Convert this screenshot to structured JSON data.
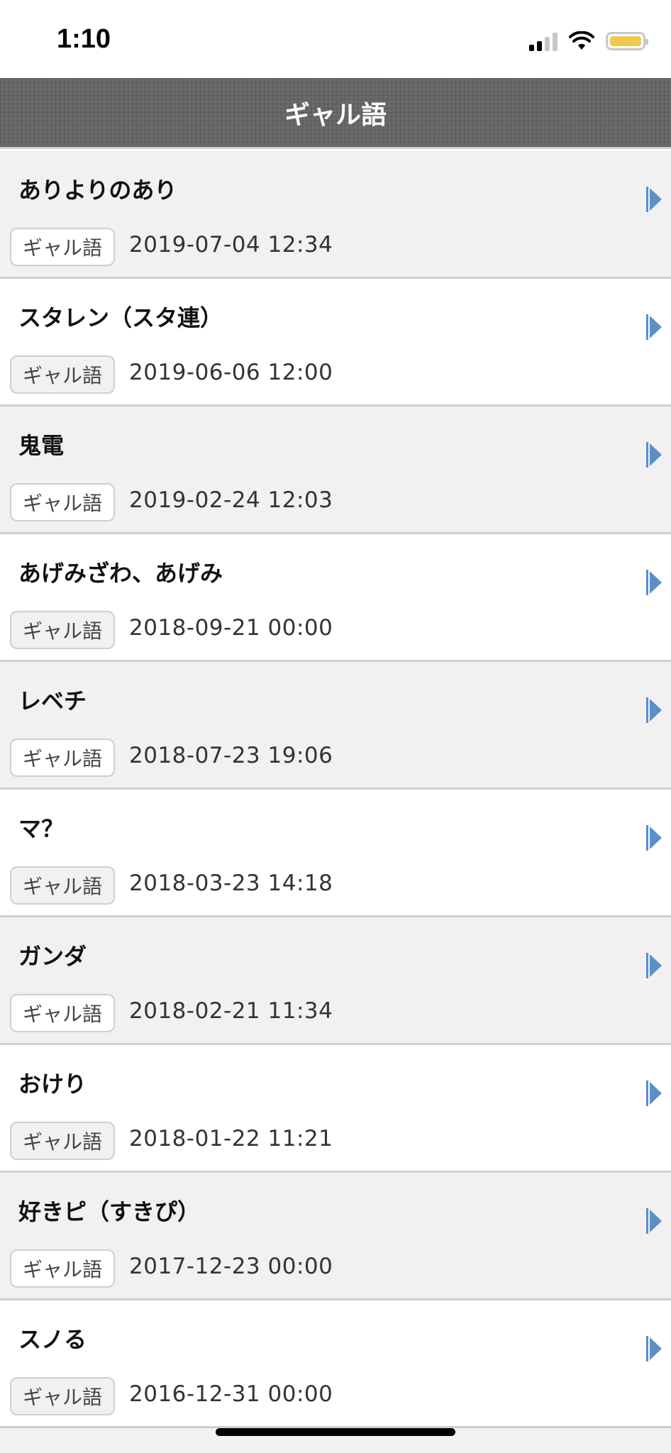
{
  "status_bar": {
    "time": "1:10"
  },
  "navbar": {
    "title": "ギャル語"
  },
  "items": [
    {
      "word": "ありよりのあり",
      "tag": "ギャル語",
      "date": "2019-07-04 12:34"
    },
    {
      "word": "スタレン（スタ連）",
      "tag": "ギャル語",
      "date": "2019-06-06 12:00"
    },
    {
      "word": "鬼電",
      "tag": "ギャル語",
      "date": "2019-02-24 12:03"
    },
    {
      "word": "あげみざわ、あげみ",
      "tag": "ギャル語",
      "date": "2018-09-21 00:00"
    },
    {
      "word": "レベチ",
      "tag": "ギャル語",
      "date": "2018-07-23 19:06"
    },
    {
      "word": "マ？",
      "tag": "ギャル語",
      "date": "2018-03-23 14:18"
    },
    {
      "word": "ガンダ",
      "tag": "ギャル語",
      "date": "2018-02-21 11:34"
    },
    {
      "word": "おけり",
      "tag": "ギャル語",
      "date": "2018-01-22 11:21"
    },
    {
      "word": "好きピ（すきぴ）",
      "tag": "ギャル語",
      "date": "2017-12-23 00:00"
    },
    {
      "word": "スノる",
      "tag": "ギャル語",
      "date": "2016-12-31 00:00"
    }
  ],
  "colors": {
    "arrow": "#5b8fc7",
    "navbar": "#6a6a6a",
    "battery": "#f2c94c"
  },
  "icons": {
    "row_arrow": "chevron-right-icon"
  }
}
